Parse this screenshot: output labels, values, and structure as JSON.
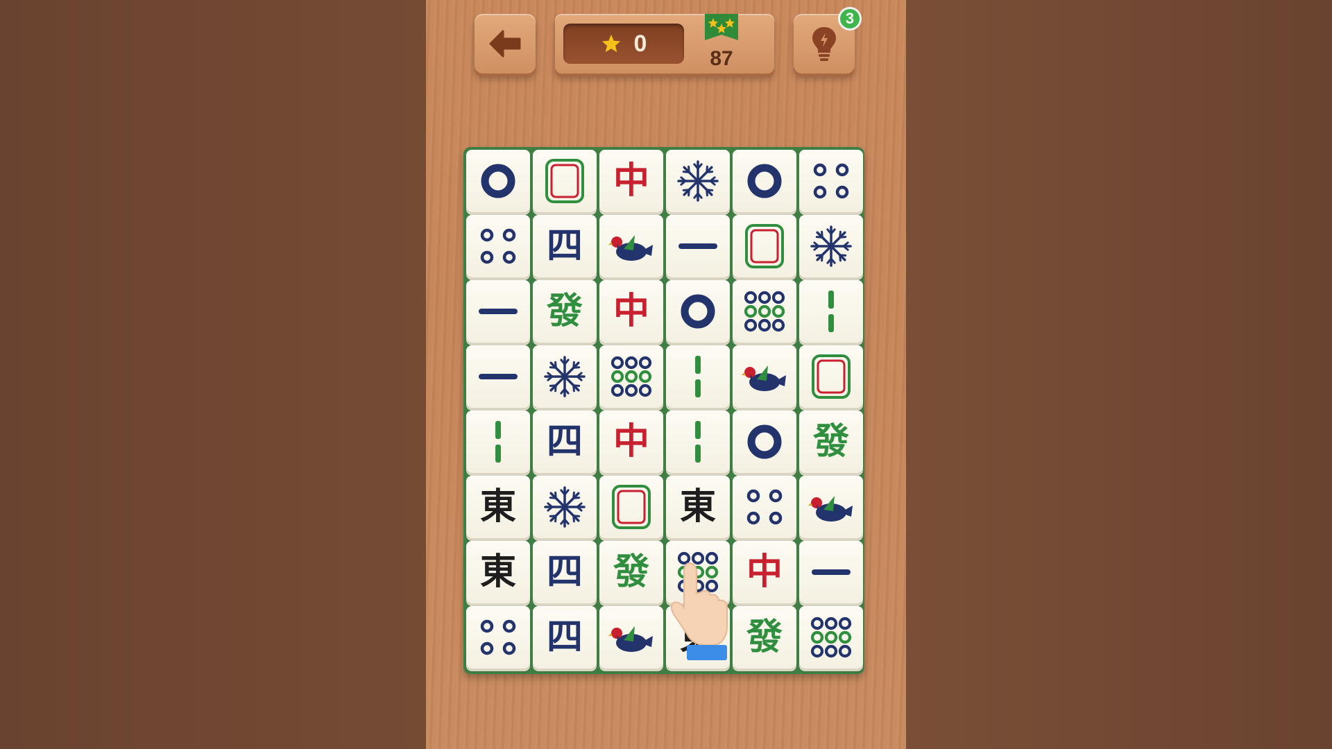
{
  "header": {
    "score": "0",
    "target": "87",
    "hints_count": "3"
  },
  "icons": {
    "back": "arrow-left-icon",
    "star": "star-icon",
    "target": "three-star-flag-icon",
    "hint": "lightbulb-icon",
    "pointer": "pointing-hand-icon"
  },
  "colors": {
    "tile_face": "#fdfbf3",
    "board_edge": "#3f7f44",
    "red_dragon": "#c8202e",
    "green_dragon": "#2f8f3f",
    "navy": "#23336b",
    "badge": "#3fb54b"
  },
  "board": {
    "columns": 6,
    "rows": 8,
    "tiles": [
      [
        "dot-1",
        "white-dragon",
        "red-dragon",
        "snowflake",
        "dot-1",
        "dot-4"
      ],
      [
        "dot-4",
        "four",
        "bird",
        "one",
        "white-dragon",
        "snowflake"
      ],
      [
        "one",
        "green-dragon",
        "red-dragon",
        "dot-1",
        "dot-9",
        "bamboo-2"
      ],
      [
        "one",
        "snowflake",
        "dot-9",
        "bamboo-2",
        "bird",
        "white-dragon"
      ],
      [
        "bamboo-2",
        "four",
        "red-dragon",
        "bamboo-2",
        "dot-1",
        "green-dragon"
      ],
      [
        "east",
        "snowflake",
        "white-dragon",
        "east",
        "dot-4",
        "bird"
      ],
      [
        "east",
        "four",
        "green-dragon",
        "dot-9",
        "red-dragon",
        "one"
      ],
      [
        "dot-4",
        "four",
        "bird",
        "east",
        "green-dragon",
        "dot-9"
      ]
    ],
    "glyphs": {
      "red-dragon": "中",
      "green-dragon": "發",
      "four": "四",
      "east": "東"
    }
  }
}
